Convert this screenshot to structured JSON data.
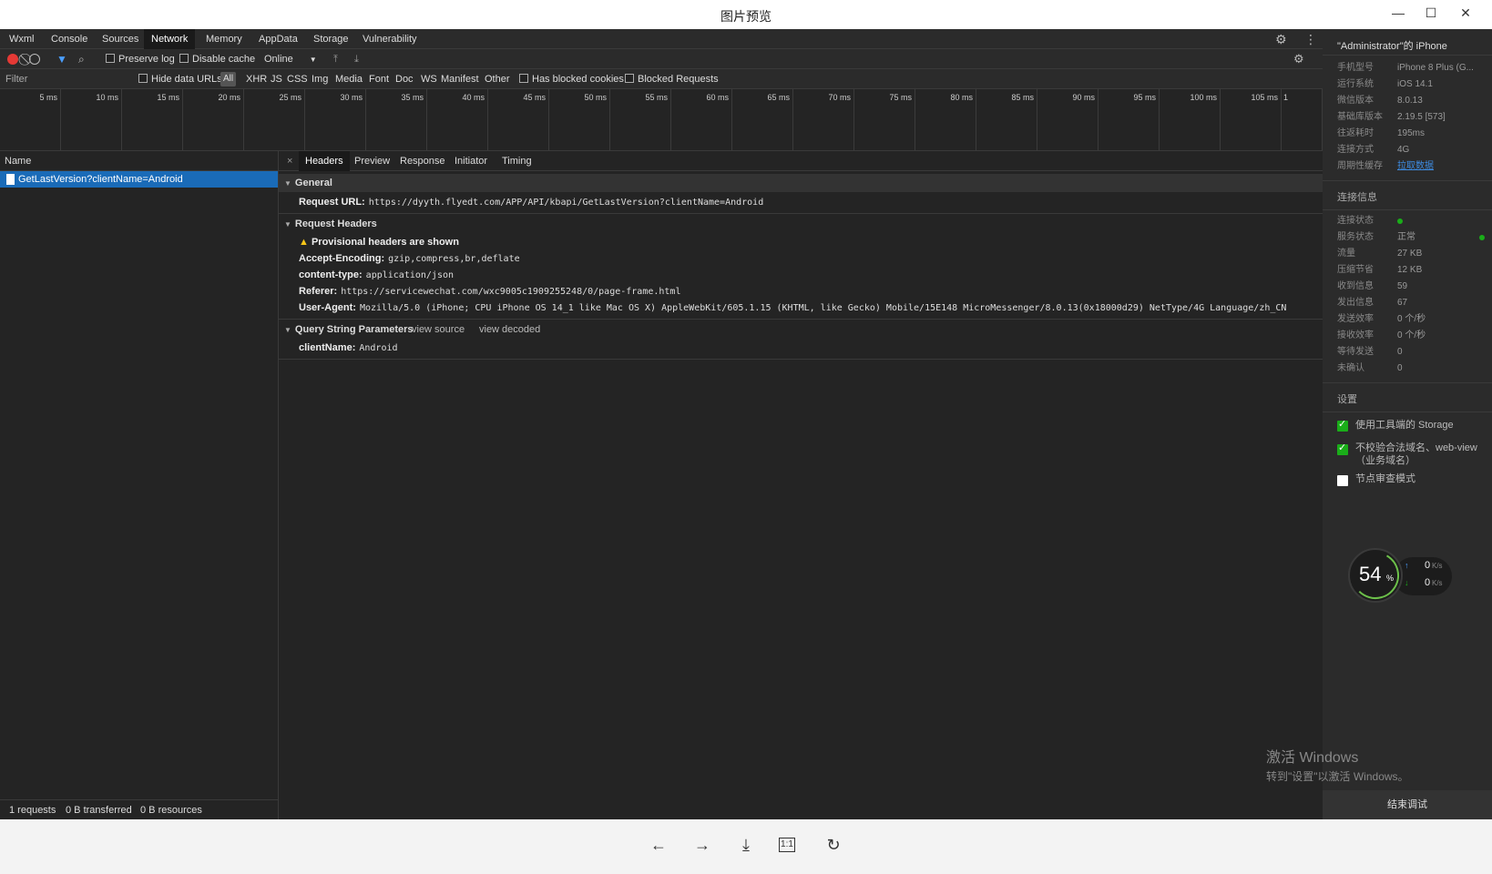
{
  "window": {
    "title": "图片预览",
    "minimize": "—",
    "maximize": "☐",
    "close": "✕"
  },
  "tabs": [
    "Wxml",
    "Console",
    "Sources",
    "Network",
    "Memory",
    "AppData",
    "Storage",
    "Vulnerability"
  ],
  "active_tab": "Network",
  "toolbar": {
    "preserve_log": "Preserve log",
    "disable_cache": "Disable cache",
    "throttle": "Online"
  },
  "filter": {
    "placeholder": "Filter",
    "hide_data_urls": "Hide data URLs",
    "types": [
      "All",
      "XHR",
      "JS",
      "CSS",
      "Img",
      "Media",
      "Font",
      "Doc",
      "WS",
      "Manifest",
      "Other"
    ],
    "has_blocked_cookies": "Has blocked cookies",
    "blocked_requests": "Blocked Requests"
  },
  "timeline": {
    "ticks": [
      "5 ms",
      "10 ms",
      "15 ms",
      "20 ms",
      "25 ms",
      "30 ms",
      "35 ms",
      "40 ms",
      "45 ms",
      "50 ms",
      "55 ms",
      "60 ms",
      "65 ms",
      "70 ms",
      "75 ms",
      "80 ms",
      "85 ms",
      "90 ms",
      "95 ms",
      "100 ms",
      "105 ms",
      "1"
    ]
  },
  "requests": {
    "header": "Name",
    "items": [
      "GetLastVersion?clientName=Android"
    ]
  },
  "status": {
    "requests": "1 requests",
    "transferred": "0 B transferred",
    "resources": "0 B resources"
  },
  "detail": {
    "tabs": [
      "Headers",
      "Preview",
      "Response",
      "Initiator",
      "Timing"
    ],
    "close": "×",
    "general": {
      "title": "General",
      "request_url_key": "Request URL:",
      "request_url": "https://dyyth.flyedt.com/APP/API/kbapi/GetLastVersion?clientName=Android"
    },
    "request_headers": {
      "title": "Request Headers",
      "warning": "Provisional headers are shown",
      "items": [
        {
          "k": "Accept-Encoding:",
          "v": "gzip,compress,br,deflate"
        },
        {
          "k": "content-type:",
          "v": "application/json"
        },
        {
          "k": "Referer:",
          "v": "https://servicewechat.com/wxc9005c1909255248/0/page-frame.html"
        },
        {
          "k": "User-Agent:",
          "v": "Mozilla/5.0 (iPhone; CPU iPhone OS 14_1 like Mac OS X) AppleWebKit/605.1.15 (KHTML, like Gecko) Mobile/15E148 MicroMessenger/8.0.13(0x18000d29) NetType/4G Language/zh_CN"
        }
      ]
    },
    "query": {
      "title": "Query String Parameters",
      "view_source": "view source",
      "view_decoded": "view decoded",
      "items": [
        {
          "k": "clientName:",
          "v": "Android"
        }
      ]
    }
  },
  "right_panel": {
    "device": "\"Administrator\"的 iPhone",
    "info": [
      {
        "k": "手机型号",
        "v": "iPhone 8 Plus (G..."
      },
      {
        "k": "运行系统",
        "v": "iOS 14.1"
      },
      {
        "k": "微信版本",
        "v": "8.0.13"
      },
      {
        "k": "基础库版本",
        "v": "2.19.5 [573]"
      },
      {
        "k": "往返耗时",
        "v": "195ms"
      },
      {
        "k": "连接方式",
        "v": "4G"
      },
      {
        "k": "周期性缓存",
        "v": "拉取数据"
      }
    ],
    "conn_title": "连接信息",
    "conn": [
      {
        "k": "连接状态",
        "v": ""
      },
      {
        "k": "服务状态",
        "v": "正常"
      },
      {
        "k": "流量",
        "v": "27 KB"
      },
      {
        "k": "压缩节省",
        "v": "12 KB"
      },
      {
        "k": "收到信息",
        "v": "59"
      },
      {
        "k": "发出信息",
        "v": "67"
      },
      {
        "k": "发送效率",
        "v": "0 个/秒"
      },
      {
        "k": "接收效率",
        "v": "0 个/秒"
      },
      {
        "k": "等待发送",
        "v": "0"
      },
      {
        "k": "未确认",
        "v": "0"
      }
    ],
    "settings_title": "设置",
    "settings": [
      {
        "label": "使用工具端的 Storage",
        "checked": true
      },
      {
        "label": "不校验合法域名、web-view（业务域名）",
        "checked": true
      },
      {
        "label": "节点审查模式",
        "checked": false
      }
    ],
    "speed": {
      "percent": "54",
      "pct_sign": "%",
      "up": "0",
      "down": "0",
      "unit": "K/s"
    },
    "end_debug": "结束调试"
  },
  "watermark": {
    "line1": "激活 Windows",
    "line2": "转到\"设置\"以激活 Windows。"
  },
  "bottom_bar": {
    "icons": [
      "←",
      "→",
      "⤓",
      "1:1",
      "↻"
    ]
  },
  "colors": {
    "accent_blue": "#1a6bb8",
    "green": "#1aad19",
    "record_red": "#e53935"
  }
}
